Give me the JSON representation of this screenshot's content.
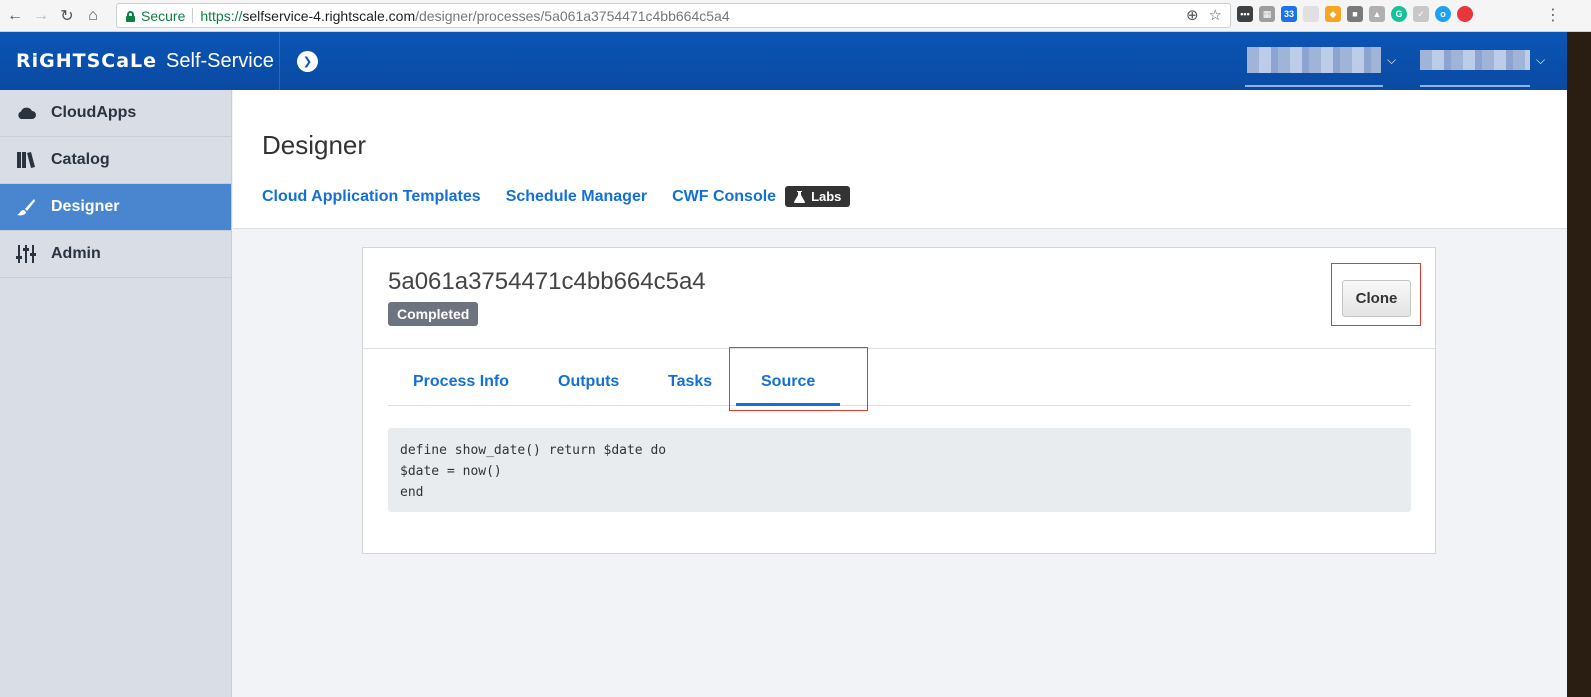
{
  "browser": {
    "secure_label": "Secure",
    "url_scheme": "https://",
    "url_host": "selfservice-4.rightscale.com",
    "url_path": "/designer/processes/5a061a3754471c4bb664c5a4",
    "ext_badge": "33"
  },
  "header": {
    "logo": "RiGHTSCaLe",
    "product": "Self-Service"
  },
  "sidebar": {
    "items": [
      {
        "label": "CloudApps",
        "icon": "cloud-icon"
      },
      {
        "label": "Catalog",
        "icon": "catalog-icon"
      },
      {
        "label": "Designer",
        "icon": "brush-icon",
        "active": true
      },
      {
        "label": "Admin",
        "icon": "sliders-icon"
      }
    ]
  },
  "page": {
    "title": "Designer",
    "sub_nav": [
      "Cloud Application Templates",
      "Schedule Manager",
      "CWF Console"
    ],
    "labs_badge": "Labs"
  },
  "process": {
    "id": "5a061a3754471c4bb664c5a4",
    "status": "Completed",
    "clone_label": "Clone",
    "tabs": [
      "Process Info",
      "Outputs",
      "Tasks",
      "Source"
    ],
    "active_tab": "Source",
    "source_code": "define show_date() return $date do\n$date = now()\nend"
  },
  "colors": {
    "header_blue": "#0b55b4",
    "link_blue": "#1570d6",
    "active_sidebar": "#4a86d0",
    "highlight_red": "#e53b2c",
    "status_gray": "#6d7480"
  }
}
